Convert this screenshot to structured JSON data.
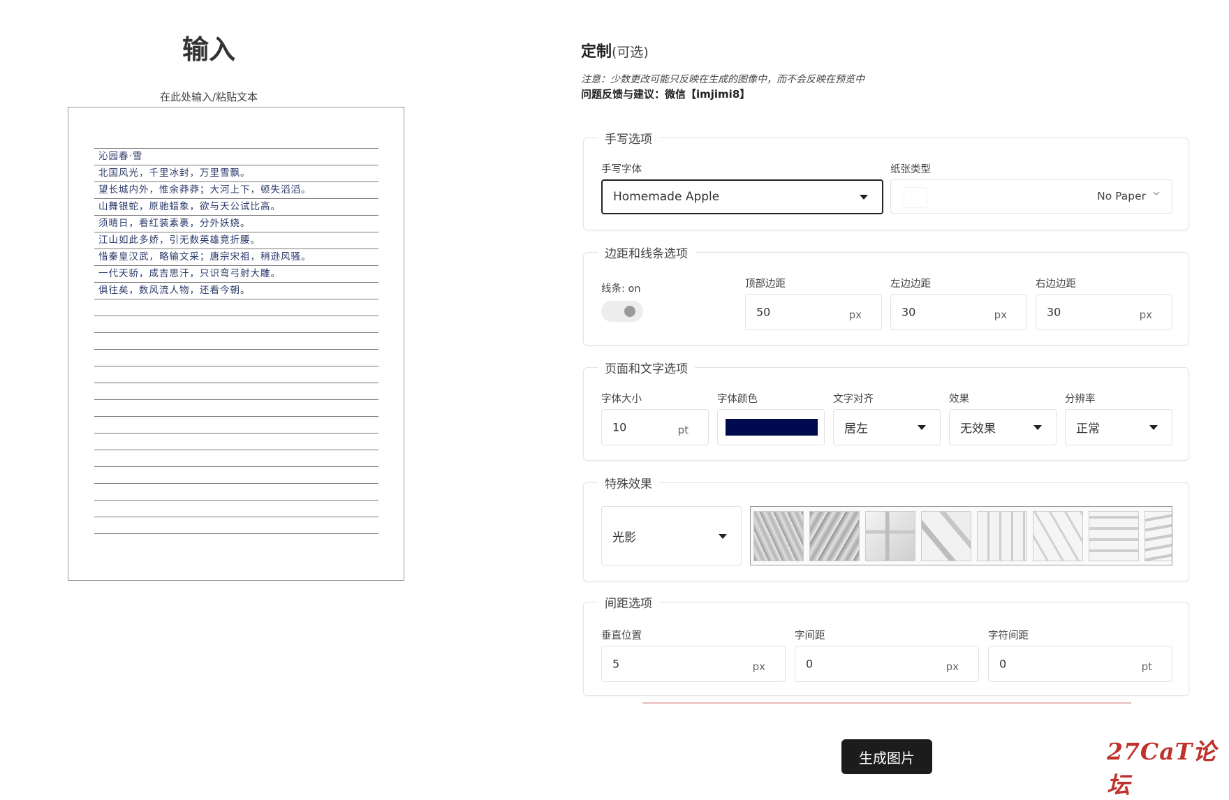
{
  "input": {
    "title": "输入",
    "hint": "在此处输入/粘贴文本",
    "lines": [
      "沁园春·雪",
      "北国风光，千里冰封，万里雪飘。",
      "望长城内外，惟余莽莽；大河上下，顿失滔滔。",
      "山舞银蛇，原驰蜡象，欲与天公试比高。",
      "须晴日，看红装素裹，分外妖娆。",
      "江山如此多娇，引无数英雄竞折腰。",
      "惜秦皇汉武，略输文采；唐宗宋祖，稍逊风骚。",
      "一代天骄，成吉思汗，只识弯弓射大雕。",
      "俱往矣，数风流人物，还看今朝。"
    ]
  },
  "custom": {
    "title": "定制",
    "optional": "(可选)",
    "note": "注意：少数更改可能只反映在生成的图像中，而不会反映在预览中",
    "feedback": "问题反馈与建议：微信【imjimi8】"
  },
  "handwriting": {
    "legend": "手写选项",
    "font_label": "手写字体",
    "font_value": "Homemade Apple",
    "paper_label": "纸张类型",
    "paper_value": "No Paper"
  },
  "margins": {
    "legend": "边距和线条选项",
    "lines_label": "线条: on",
    "top_label": "顶部边距",
    "top_value": "50",
    "left_label": "左边边距",
    "left_value": "30",
    "right_label": "右边边距",
    "right_value": "30",
    "unit": "px"
  },
  "page_text": {
    "legend": "页面和文字选项",
    "size_label": "字体大小",
    "size_value": "10",
    "size_unit": "pt",
    "color_label": "字体颜色",
    "color_value": "#000b4f",
    "align_label": "文字对齐",
    "align_value": "居左",
    "effect_label": "效果",
    "effect_value": "无效果",
    "resolution_label": "分辨率",
    "resolution_value": "正常"
  },
  "special": {
    "legend": "特殊效果",
    "value": "光影"
  },
  "spacing": {
    "legend": "间距选项",
    "vertical_label": "垂直位置",
    "vertical_value": "5",
    "vertical_unit": "px",
    "word_label": "字间距",
    "word_value": "0",
    "word_unit": "px",
    "char_label": "字符间距",
    "char_value": "0",
    "char_unit": "pt"
  },
  "actions": {
    "generate": "生成图片"
  },
  "watermark": "27CaT论坛"
}
